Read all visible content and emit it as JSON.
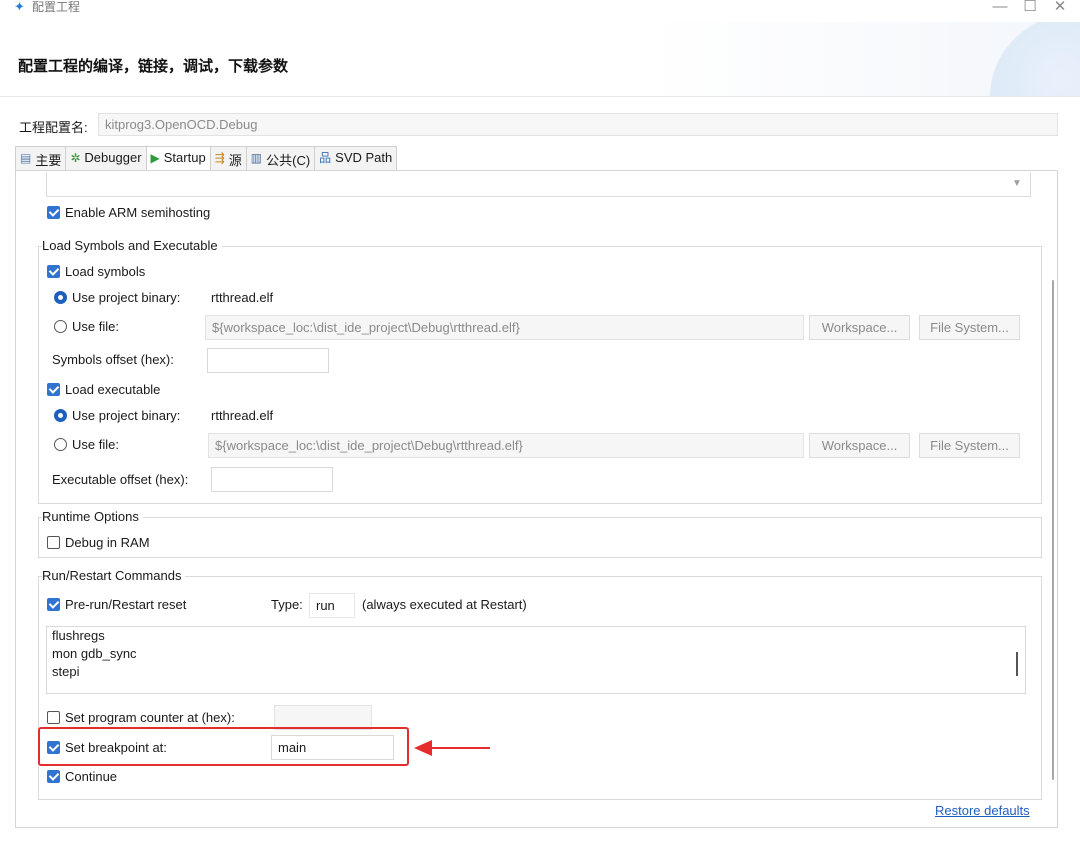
{
  "window": {
    "title": "配置工程",
    "minimize": "—",
    "maximize": "☐",
    "close": "✕"
  },
  "header": {
    "title": "配置工程的编译，链接，调试，下载参数"
  },
  "config_name": {
    "label": "工程配置名:",
    "value": "kitprog3.OpenOCD.Debug"
  },
  "tabs": [
    {
      "label": "主要",
      "icon": "document-icon",
      "glyph": "▤"
    },
    {
      "label": "Debugger",
      "icon": "debugger-bug-icon",
      "glyph": "✲"
    },
    {
      "label": "Startup",
      "icon": "run-arrow-icon",
      "glyph": "▶"
    },
    {
      "label": "源",
      "icon": "source-icon",
      "glyph": "⇶"
    },
    {
      "label": "公共(C)",
      "icon": "common-icon",
      "glyph": "▥"
    },
    {
      "label": "SVD Path",
      "icon": "svd-tree-icon",
      "glyph": "品"
    }
  ],
  "semihosting": {
    "label": "Enable ARM semihosting",
    "checked": true
  },
  "load_group": {
    "title": "Load Symbols and Executable",
    "load_symbols": {
      "label": "Load symbols",
      "checked": true
    },
    "symbols_use_project": {
      "label": "Use project binary:",
      "value": "rtthread.elf",
      "selected": true
    },
    "symbols_use_file": {
      "label": "Use file:",
      "path": "${workspace_loc:\\dist_ide_project\\Debug\\rtthread.elf}",
      "selected": false
    },
    "symbols_workspace": "Workspace...",
    "symbols_filesystem": "File System...",
    "symbols_offset": {
      "label": "Symbols offset (hex):",
      "value": ""
    },
    "load_executable": {
      "label": "Load executable",
      "checked": true
    },
    "exe_use_project": {
      "label": "Use project binary:",
      "value": "rtthread.elf",
      "selected": true
    },
    "exe_use_file": {
      "label": "Use file:",
      "path": "${workspace_loc:\\dist_ide_project\\Debug\\rtthread.elf}",
      "selected": false
    },
    "exe_workspace": "Workspace...",
    "exe_filesystem": "File System...",
    "exe_offset": {
      "label": "Executable offset (hex):",
      "value": ""
    }
  },
  "runtime_group": {
    "title": "Runtime Options",
    "debug_in_ram": {
      "label": "Debug in RAM",
      "checked": false
    }
  },
  "run_group": {
    "title": "Run/Restart Commands",
    "pre_run": {
      "label": "Pre-run/Restart reset",
      "checked": true
    },
    "type_label": "Type:",
    "type_value": "run",
    "type_note": "(always executed at Restart)",
    "commands": [
      "flushregs",
      "mon gdb_sync",
      "stepi"
    ],
    "set_pc": {
      "label": "Set program counter at (hex):",
      "checked": false,
      "value": ""
    },
    "set_breakpoint": {
      "label": "Set breakpoint at:",
      "checked": true,
      "value": "main"
    },
    "continue": {
      "label": "Continue",
      "checked": true
    }
  },
  "restore_defaults": "Restore defaults",
  "colors": {
    "highlight": "#e52d2d",
    "accent": "#2f74d0",
    "link": "#1f5fbf"
  }
}
